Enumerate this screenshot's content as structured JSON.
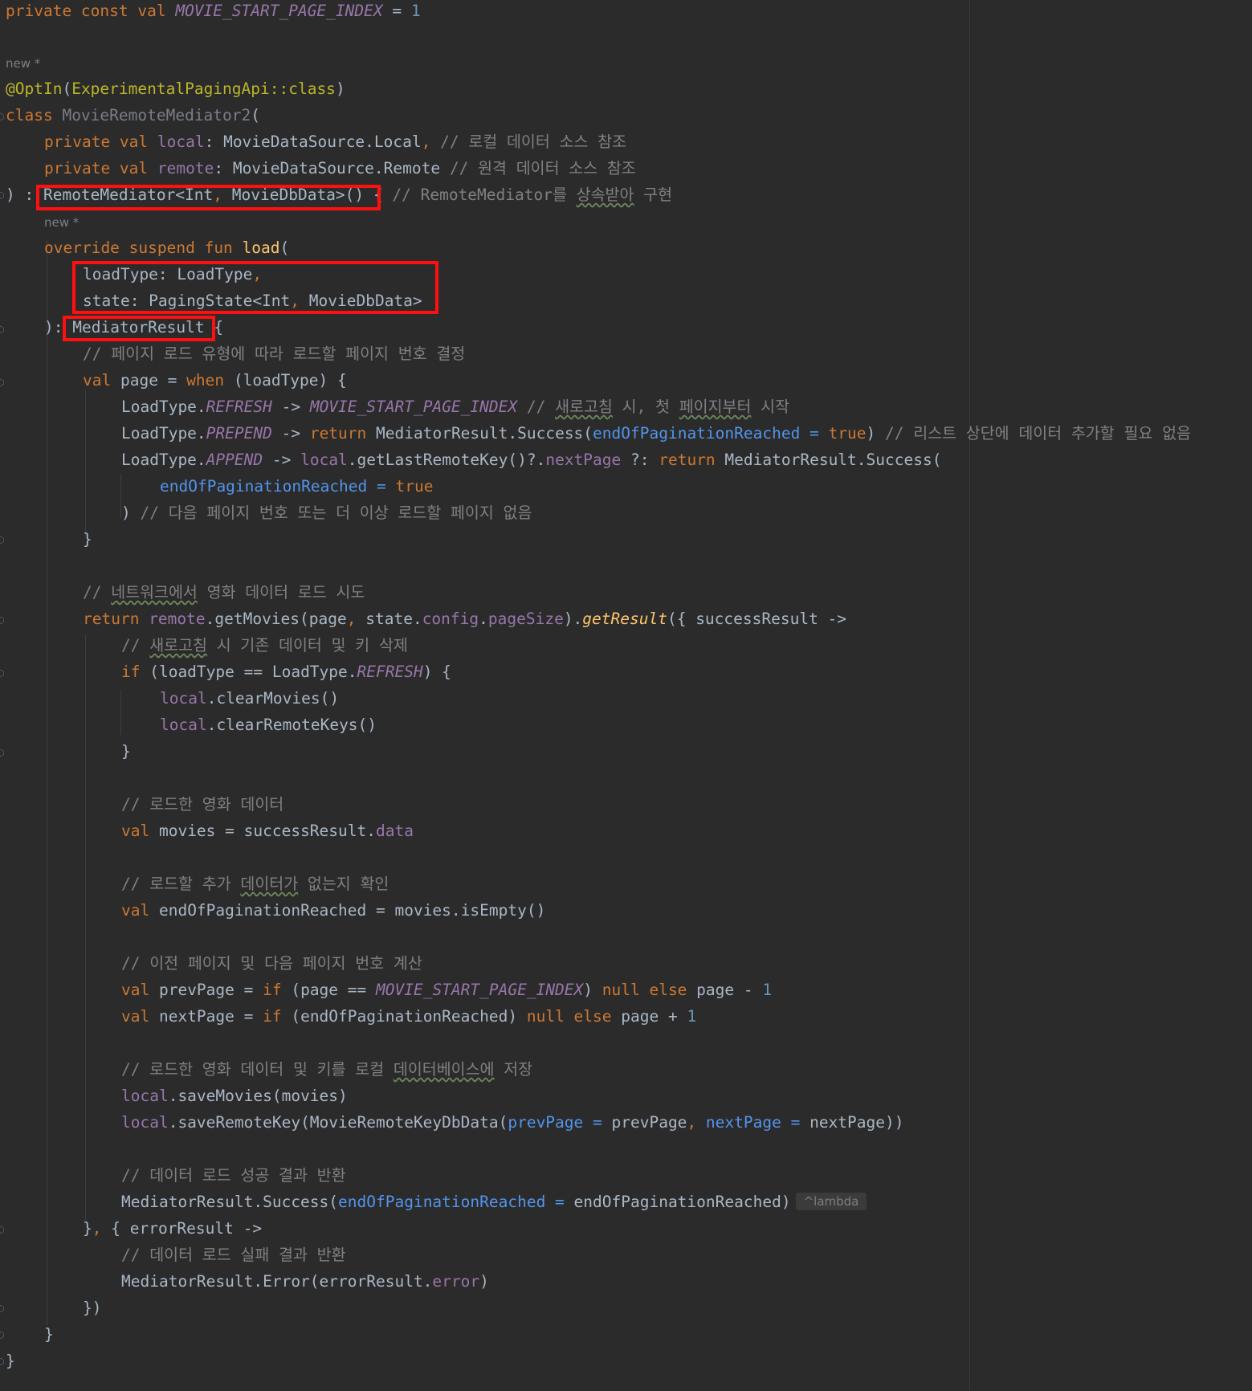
{
  "editor": {
    "hints": {
      "new_class": "new *",
      "new_fun": "new *"
    },
    "lines": {
      "l1": {
        "kw": "private const val ",
        "name": "MOVIE_START_PAGE_INDEX",
        "eq": " = ",
        "num": "1"
      },
      "l3": {
        "anno": "@OptIn",
        "lp": "(",
        "cls": "ExperimentalPagingApi::class",
        "rp": ")"
      },
      "l4": {
        "kw": "class ",
        "name": "MovieRemoteMediator2",
        "rest": "("
      },
      "l5": {
        "kw": "private val ",
        "prop": "local",
        "type": ": MovieDataSource.Local",
        "comma": ",",
        "comment": " // 로컬 데이터 소스 참조"
      },
      "l6": {
        "kw": "private val ",
        "prop": "remote",
        "type": ": MovieDataSource.Remote",
        "comment": " // 원격 데이터 소스 참조"
      },
      "l7": {
        "pre": ") : ",
        "type": "RemoteMediator<Int",
        "comma": ",",
        "type2": " MovieDbData>()",
        "brace": " { ",
        "comment1": "// RemoteMediator를 ",
        "comment_w": "상속받아",
        "comment2": " 구현"
      },
      "l8": {
        "kw": "override suspend fun ",
        "fn": "load",
        "rest": "("
      },
      "l9": {
        "text": "loadType: LoadType",
        "comma": ","
      },
      "l10": {
        "text1": "state: PagingState<Int",
        "comma": ",",
        "text2": " MovieDbData>"
      },
      "l11": {
        "pre": "): ",
        "type": "MediatorResult",
        "rest": " {"
      },
      "l12": {
        "comment": "// 페이지 로드 유형에 따라 로드할 페이지 번호 결정"
      },
      "l13": {
        "kw": "val ",
        "text": "page = ",
        "kw2": "when",
        "rest": " (loadType) {"
      },
      "l14": {
        "pre": "LoadType.",
        "const": "REFRESH",
        "arrow": " -> ",
        "const2": "MOVIE_START_PAGE_INDEX",
        "comment1": " // ",
        "comment_w": "새로고침",
        "comment2": " 시, 첫 ",
        "comment_w2": "페이지부터",
        "comment3": " 시작"
      },
      "l15": {
        "pre": "LoadType.",
        "const": "PREPEND",
        "arrow": " -> ",
        "kw": "return",
        "text": " MediatorResult.Success(",
        "param": "endOfPaginationReached",
        "eq": " = ",
        "kw2": "true",
        "rp": ")",
        "comment": " // 리스트 상단에 데이터 추가할 필요 없음"
      },
      "l16": {
        "pre": "LoadType.",
        "const": "APPEND",
        "arrow": " -> ",
        "prop": "local",
        "text": ".getLastRemoteKey()?.",
        "prop2": "nextPage",
        "elvis": " ?: ",
        "kw": "return",
        "text2": " MediatorResult.Success("
      },
      "l17": {
        "param": "endOfPaginationReached",
        "eq": " = ",
        "kw": "true"
      },
      "l18": {
        "text": ") ",
        "comment": "// 다음 페이지 번호 또는 더 이상 로드할 페이지 없음"
      },
      "l19": {
        "text": "}"
      },
      "l21": {
        "comment1": "// ",
        "comment_w": "네트워크에서",
        "comment2": " 영화 데이터 로드 시도"
      },
      "l22": {
        "kw": "return ",
        "prop": "remote",
        "text": ".getMovies(page",
        "comma": ",",
        "text2": " state.",
        "prop2": "config",
        "dot": ".",
        "prop3": "pageSize",
        "text3": ").",
        "fn": "getResult",
        "text4": "({ successResult ->"
      },
      "l23": {
        "comment1": "// ",
        "comment_w": "새로고침",
        "comment2": " 시 기존 데이터 및 키 삭제"
      },
      "l24": {
        "kw": "if",
        "text": " (loadType == LoadType.",
        "const": "REFRESH",
        "rest": ") {"
      },
      "l25": {
        "prop": "local",
        "text": ".clearMovies()"
      },
      "l26": {
        "prop": "local",
        "text": ".clearRemoteKeys()"
      },
      "l27": {
        "text": "}"
      },
      "l29": {
        "comment": "// 로드한 영화 데이터"
      },
      "l30": {
        "kw": "val ",
        "text": "movies = successResult.",
        "prop": "data"
      },
      "l32": {
        "comment1": "// 로드할 추가 ",
        "comment_w": "데이터가",
        "comment2": " 없는지 확인"
      },
      "l33": {
        "kw": "val ",
        "text": "endOfPaginationReached = movies.isEmpty()"
      },
      "l35": {
        "comment": "// 이전 페이지 및 다음 페이지 번호 계산"
      },
      "l36": {
        "kw": "val ",
        "text": "prevPage = ",
        "kw2": "if",
        "text2": " (page == ",
        "const": "MOVIE_START_PAGE_INDEX",
        "text3": ") ",
        "kw3": "null else",
        "text4": " page - ",
        "num": "1"
      },
      "l37": {
        "kw": "val ",
        "text": "nextPage = ",
        "kw2": "if",
        "text2": " (endOfPaginationReached) ",
        "kw3": "null else",
        "text4": " page + ",
        "num": "1"
      },
      "l39": {
        "comment1": "// 로드한 영화 데이터 및 키를 로컬 ",
        "comment_w": "데이터베이스에",
        "comment2": " 저장"
      },
      "l40": {
        "prop": "local",
        "text": ".saveMovies(movies)"
      },
      "l41": {
        "prop": "local",
        "text": ".saveRemoteKey(MovieRemoteKeyDbData(",
        "param": "prevPage",
        "eq": " = ",
        "text2": "prevPage",
        "comma": ",",
        "param2": " nextPage",
        "eq2": " = ",
        "text3": "nextPage))"
      },
      "l43": {
        "comment": "// 데이터 로드 성공 결과 반환"
      },
      "l44": {
        "text": "MediatorResult.Success(",
        "param": "endOfPaginationReached",
        "eq": " = ",
        "text2": "endOfPaginationReached)",
        "hint": "^lambda"
      },
      "l45": {
        "text": "}",
        "comma": ",",
        "text2": " { errorResult ->"
      },
      "l46": {
        "comment": "// 데이터 로드 실패 결과 반환"
      },
      "l47": {
        "text": "MediatorResult.Error(errorResult.",
        "prop": "error",
        "rp": ")"
      },
      "l48": {
        "text": "})"
      },
      "l49": {
        "text": "}"
      },
      "l50": {
        "text": "}"
      }
    }
  }
}
